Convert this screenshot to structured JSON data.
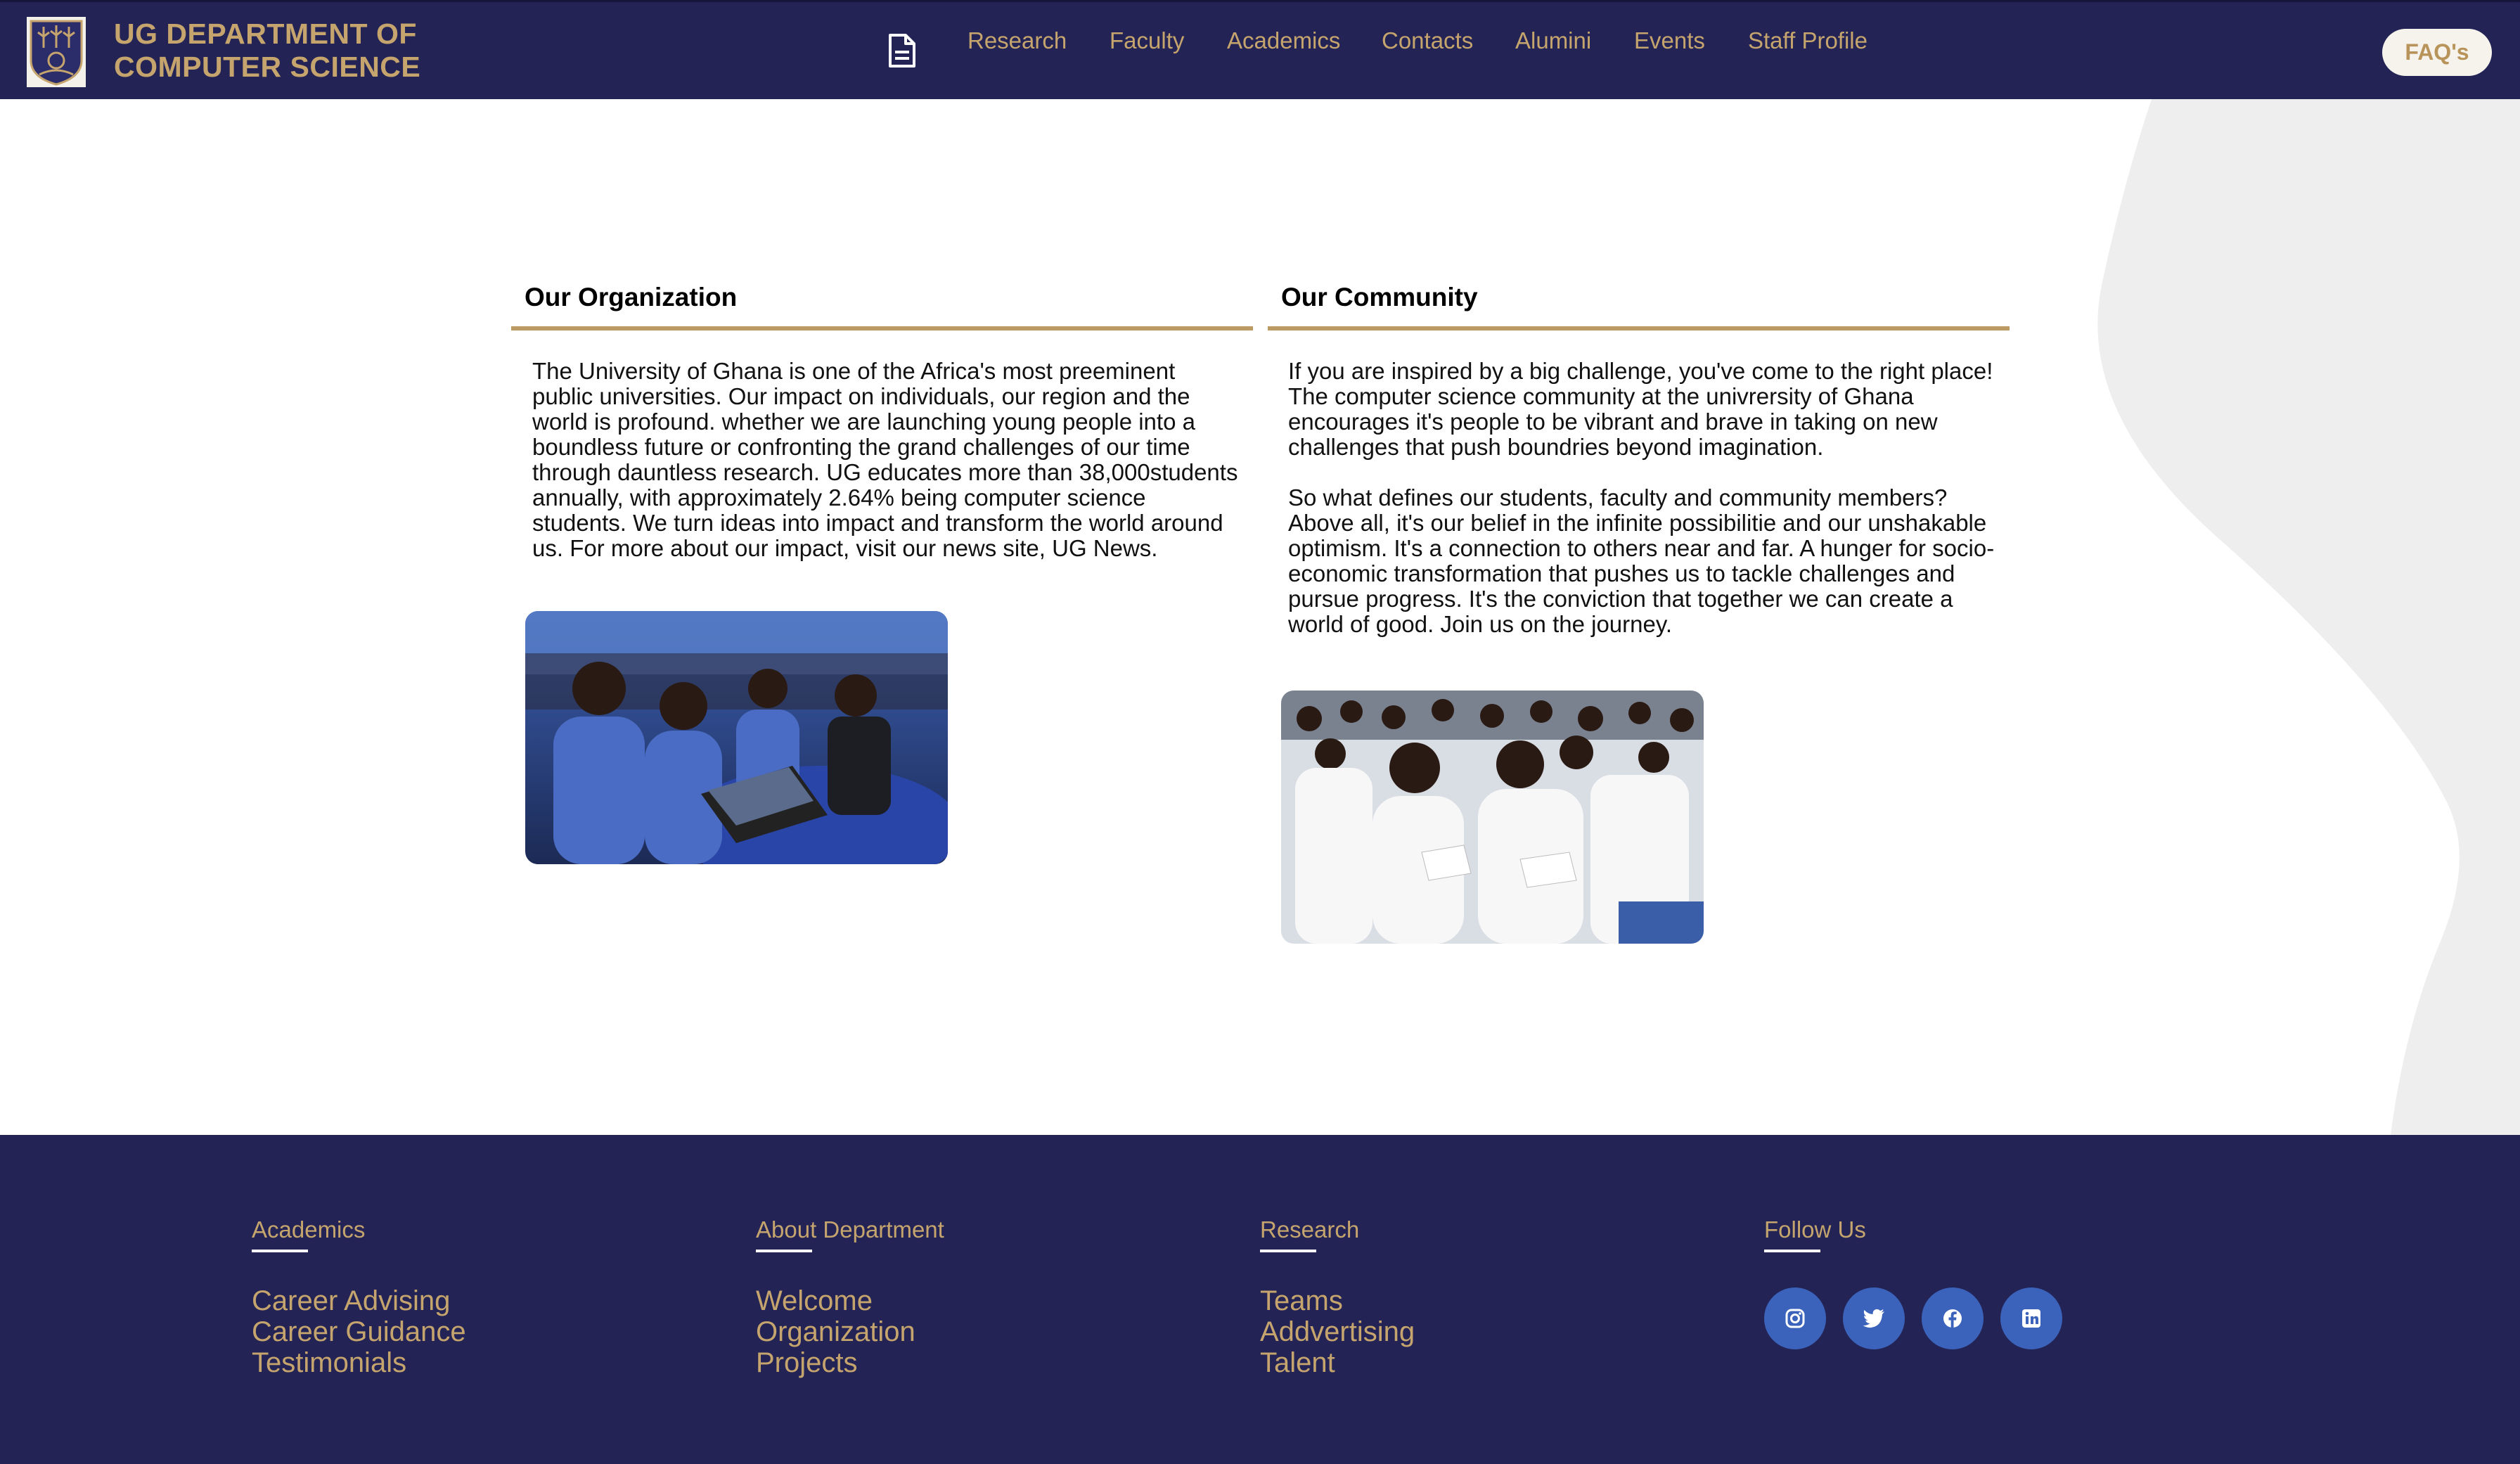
{
  "header": {
    "brand_line1": "UG DEPARTMENT OF",
    "brand_line2": "COMPUTER SCIENCE",
    "nav": [
      {
        "label": "Research"
      },
      {
        "label": "Faculty"
      },
      {
        "label": "Academics"
      },
      {
        "label": "Contacts"
      },
      {
        "label": "Alumini"
      },
      {
        "label": "Events"
      },
      {
        "label": "Staff Profile"
      }
    ],
    "faq_label": "FAQ's",
    "icons": {
      "crest": "university-crest-logo",
      "doc": "document-icon"
    }
  },
  "organization": {
    "title": "Our Organization",
    "text": "The University of Ghana is one of the Africa's most preeminent public universities. Our impact on individuals, our region and the world is profound. whether we are launching young people into a boundless future or confronting the grand challenges of our time through dauntless research. UG educates more than 38,000students annually, with approximately 2.64% being computer science students. We turn ideas into impact and transform the world around us. For more about our impact, visit our news site, UG News."
  },
  "community": {
    "title": "Our Community",
    "paragraphs": [
      "If you are inspired by a big challenge, you've come to the right place! The computer science community at the univrersity of Ghana encourages it's people to be vibrant and brave in taking on new challenges that push boundries beyond imagination.",
      "So what defines our students, faculty and community members? Above all, it's our belief in the infinite possibilitie and our unshakable optimism. It's a connection to others near and far. A hunger for socio-economic transformation that pushes us to tackle challenges and pursue progress. It's the conviction that together we can create a world of good. Join us on the journey."
    ]
  },
  "footer": {
    "columns": [
      {
        "heading": "Academics",
        "links": [
          "Career Advising",
          "Career Guidance",
          "Testimonials"
        ]
      },
      {
        "heading": "About Department",
        "links": [
          "Welcome",
          "Organization",
          "Projects"
        ]
      },
      {
        "heading": "Research",
        "links": [
          "Teams",
          "Addvertising",
          "Talent"
        ]
      },
      {
        "heading": "Follow Us",
        "links": []
      }
    ],
    "social": [
      "instagram-icon",
      "twitter-icon",
      "facebook-icon",
      "linkedin-icon"
    ]
  },
  "colors": {
    "navy": "#232455",
    "gold": "#c5a46d",
    "rule": "#bb9a64",
    "social_bg": "#3b63bb",
    "wave": "#eeeeee"
  }
}
